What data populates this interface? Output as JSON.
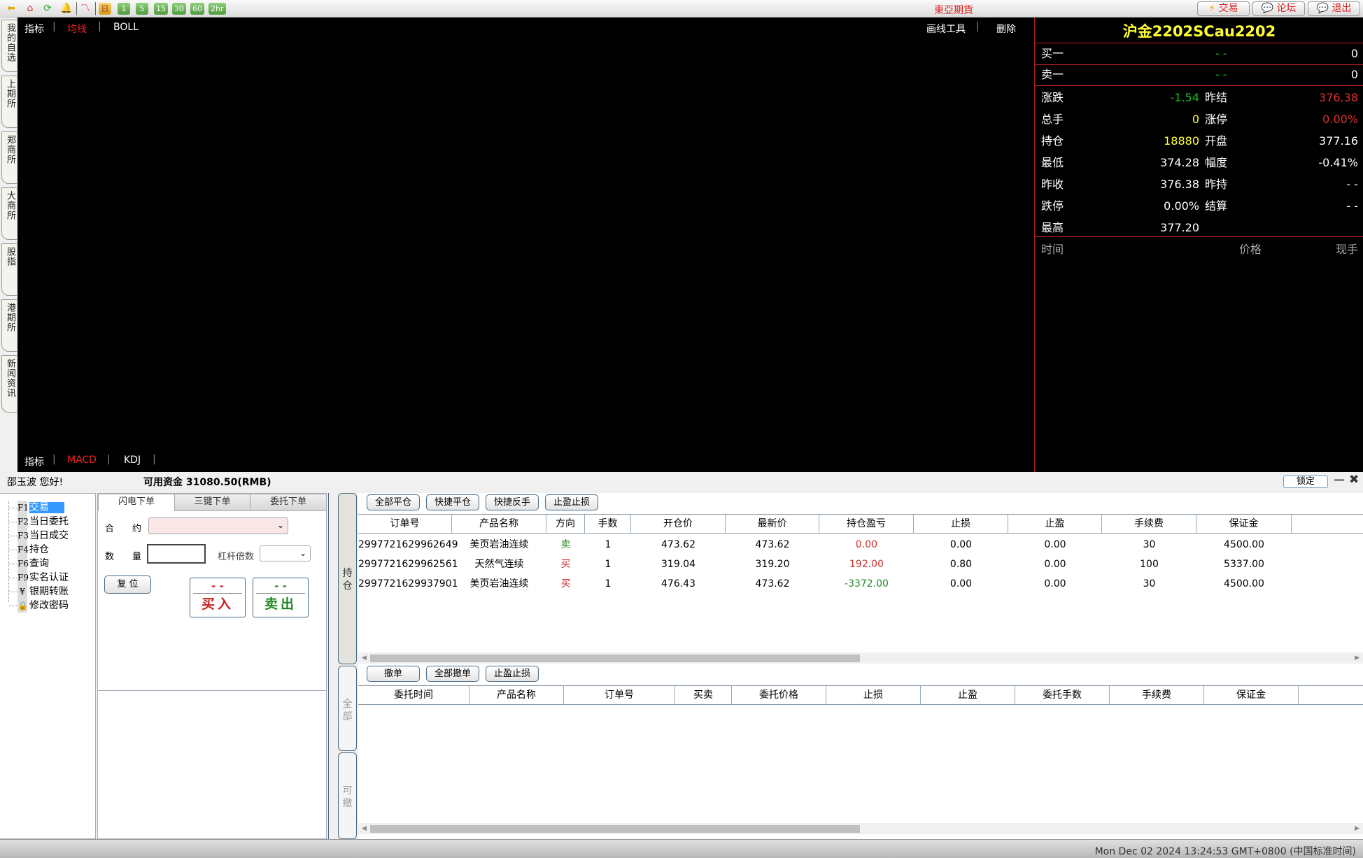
{
  "toolbar": {
    "icons": [
      "back-arrow-icon",
      "home-icon",
      "refresh-icon",
      "bell-icon",
      "trend-chart-icon"
    ],
    "periods": [
      "日",
      "1",
      "5",
      "15",
      "30",
      "60",
      "2hr"
    ],
    "brand": "東亞期貨",
    "buttons": [
      {
        "icon": "lightning-icon",
        "label": "交易"
      },
      {
        "icon": "chat-icon",
        "label": "论坛"
      },
      {
        "icon": "chat-icon",
        "label": "退出"
      }
    ]
  },
  "side_tabs": [
    "我的自选",
    "上期所",
    "郑商所",
    "大商所",
    "股指",
    "港期所",
    "新闻资讯"
  ],
  "chart": {
    "top_indicators": {
      "label": "指标",
      "active": "均线",
      "other": "BOLL"
    },
    "tools": {
      "draw": "画线工具",
      "delete": "删除"
    },
    "bottom_indicators": {
      "label": "指标",
      "active": "MACD",
      "other": "KDJ"
    }
  },
  "quote": {
    "title": "沪金2202SCau2202",
    "bid": {
      "label": "买一",
      "price": "- -",
      "qty": "0"
    },
    "ask": {
      "label": "卖一",
      "price": "- -",
      "qty": "0"
    },
    "stats": [
      {
        "l1": "涨跌",
        "v1": "-1.54",
        "c1": "#22bb22",
        "l2": "昨结",
        "v2": "376.38",
        "c2": "#e03030"
      },
      {
        "l1": "总手",
        "v1": "0",
        "c1": "#ffff33",
        "l2": "涨停",
        "v2": "0.00%",
        "c2": "#e03030"
      },
      {
        "l1": "持仓",
        "v1": "18880",
        "c1": "#ffff33",
        "l2": "开盘",
        "v2": "377.16",
        "c2": "#ffffff"
      },
      {
        "l1": "最低",
        "v1": "374.28",
        "c1": "#ffffff",
        "l2": "幅度",
        "v2": "-0.41%",
        "c2": "#ffffff"
      },
      {
        "l1": "昨收",
        "v1": "376.38",
        "c1": "#ffffff",
        "l2": "昨持",
        "v2": "- -",
        "c2": "#ffffff"
      },
      {
        "l1": "跌停",
        "v1": "0.00%",
        "c1": "#ffffff",
        "l2": "结算",
        "v2": "- -",
        "c2": "#ffffff"
      },
      {
        "l1": "最高",
        "v1": "377.20",
        "c1": "#ffffff",
        "l2": "",
        "v2": "",
        "c2": "#ffffff"
      }
    ],
    "ticks_header": {
      "time": "时间",
      "price": "价格",
      "qty": "现手"
    }
  },
  "account": {
    "greeting": "邵玉波 您好!",
    "funds": "可用资金 31080.50(RMB)",
    "lock": "锁定"
  },
  "nav": [
    {
      "key": "F1",
      "label": "交易",
      "selected": true
    },
    {
      "key": "F2",
      "label": "当日委托"
    },
    {
      "key": "F3",
      "label": "当日成交"
    },
    {
      "key": "F4",
      "label": "持仓"
    },
    {
      "key": "F6",
      "label": "查询"
    },
    {
      "key": "F9",
      "label": "实名认证"
    },
    {
      "key": "¥",
      "label": "银期转账"
    },
    {
      "key": "🔒",
      "label": "修改密码"
    }
  ],
  "order": {
    "tabs": [
      "闪电下单",
      "三键下单",
      "委托下单"
    ],
    "contract_label": "合　　约",
    "contract_value": "",
    "qty_label": "数　　量",
    "qty_value": "",
    "leverage_label": "杠杆倍数",
    "leverage_value": "",
    "reset": "复 位",
    "buy": {
      "price": "- -",
      "label": "买入"
    },
    "sell": {
      "price": "- -",
      "label": "卖出"
    }
  },
  "view_tabs": [
    "持仓",
    "全部",
    "可撤"
  ],
  "positions": {
    "buttons": [
      "全部平仓",
      "快捷平仓",
      "快捷反手",
      "止盈止损"
    ],
    "columns": [
      "订单号",
      "产品名称",
      "方向",
      "手数",
      "开仓价",
      "最新价",
      "持仓盈亏",
      "止损",
      "止盈",
      "手续费",
      "保证金"
    ],
    "rows": [
      [
        "2997721629962649",
        "美页岩油连续",
        "卖",
        "1",
        "473.62",
        "473.62",
        "0.00",
        "0.00",
        "0.00",
        "30",
        "4500.00"
      ],
      [
        "2997721629962561",
        "天然气连续",
        "买",
        "1",
        "319.04",
        "319.20",
        "192.00",
        "0.80",
        "0.00",
        "100",
        "5337.00"
      ],
      [
        "2997721629937901",
        "美页岩油连续",
        "买",
        "1",
        "476.43",
        "473.62",
        "-3372.00",
        "0.00",
        "0.00",
        "30",
        "4500.00"
      ]
    ],
    "colors": {
      "buy": "#d03030",
      "sell": "#228822",
      "profit": "#d03030",
      "loss": "#228822"
    }
  },
  "entrusts": {
    "buttons": [
      "撤单",
      "全部撤单",
      "止盈止损"
    ],
    "columns": [
      "委托时间",
      "产品名称",
      "订单号",
      "买卖",
      "委托价格",
      "止损",
      "止盈",
      "委托手数",
      "手续费",
      "保证金"
    ],
    "rows": []
  },
  "status": {
    "clock": "Mon Dec 02 2024 13:24:53 GMT+0800 (中国标准时间)"
  }
}
